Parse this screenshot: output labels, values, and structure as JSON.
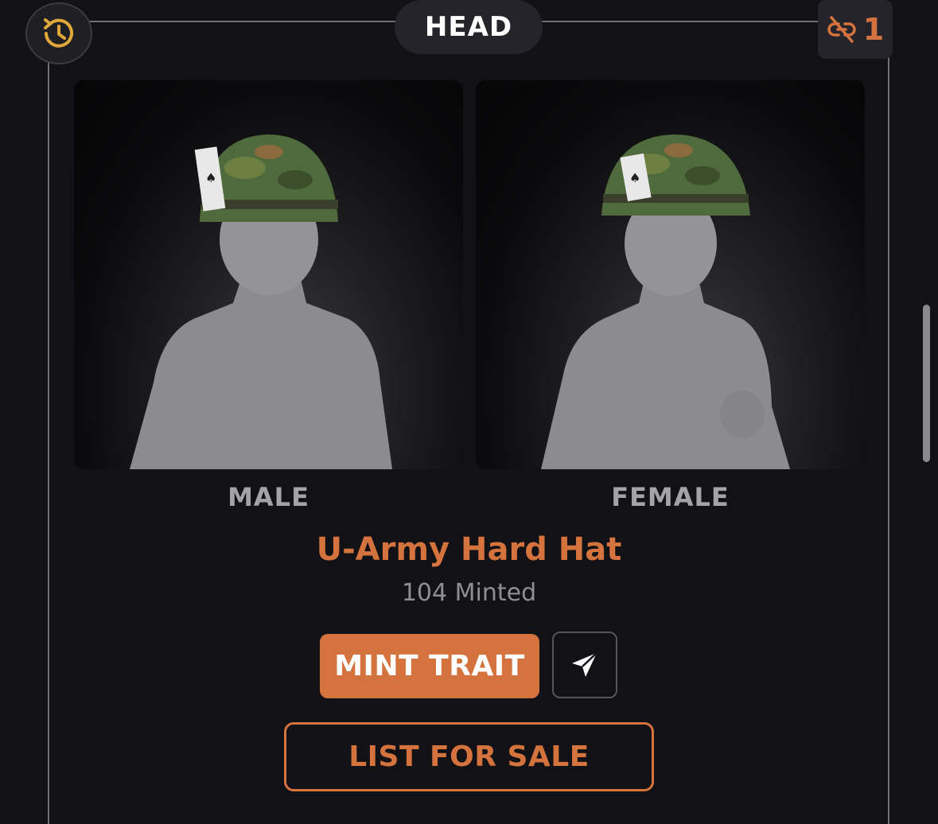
{
  "header": {
    "category_tab": "HEAD",
    "unlinked_count": "1"
  },
  "previews": [
    {
      "label": "MALE"
    },
    {
      "label": "FEMALE"
    }
  ],
  "trait": {
    "name": "U-Army Hard Hat",
    "minted": "104 Minted"
  },
  "actions": {
    "mint_label": "MINT TRAIT",
    "list_label": "LIST FOR SALE"
  },
  "colors": {
    "accent": "#d5733e",
    "background": "#111116",
    "panel": "#24242a",
    "history_icon": "#e0a83a"
  },
  "icons": {
    "history": "history-clock-icon",
    "unlinked": "unlink-chain-icon",
    "share": "send-paper-plane-icon"
  }
}
